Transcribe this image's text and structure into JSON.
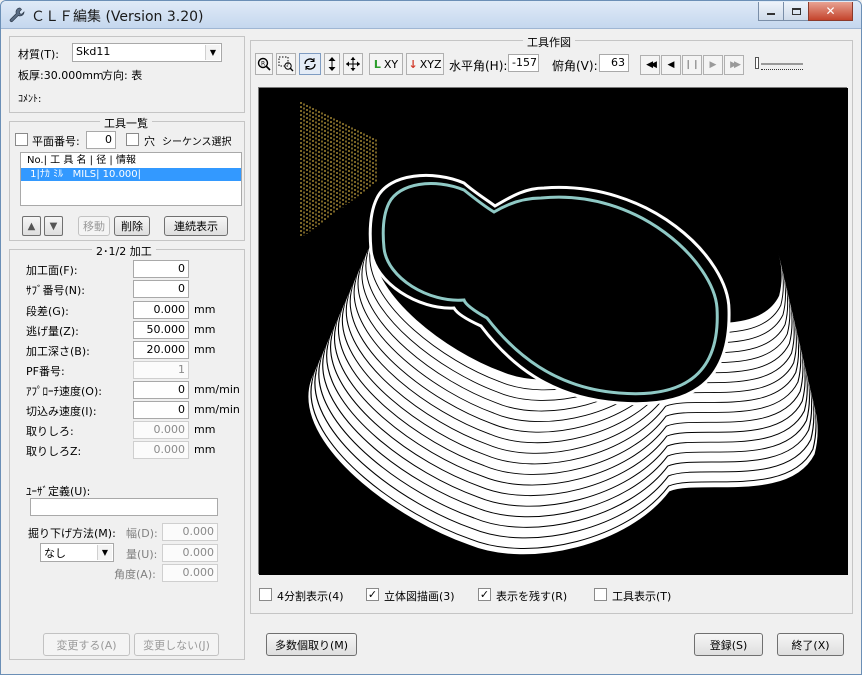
{
  "window": {
    "title": "ＣＬＦ編集 (Version 3.20)",
    "icon": "wrench-icon",
    "min_icon": "minimize-icon",
    "max_icon": "maximize-icon",
    "close_icon": "close-icon"
  },
  "material": {
    "label": "材質(T):",
    "value": "Skd11",
    "thickness_line": "板厚:30.000mm",
    "direction_line": "方向: 表",
    "comment_label": "ｺﾒﾝﾄ:"
  },
  "tool_list": {
    "title": "工具一覧",
    "plane_label": "平面番号:",
    "plane_value": "0",
    "hole_label": "穴",
    "sequence_label": "シーケンス選択",
    "header": "No.| 工 具 名 | 径 | 情報",
    "rows": [
      {
        "text": " 1|ﾅｶ ﾐﾙ   MILS| 10.000|"
      }
    ],
    "up_label": "▲",
    "down_label": "▼",
    "move_label": "移動",
    "delete_label": "削除",
    "continuous_label": "連続表示"
  },
  "machining": {
    "title": "2･1/2 加工",
    "rows": [
      {
        "label": "加工面(F):",
        "value": "0",
        "unit": "",
        "enabled": true
      },
      {
        "label": "ｻﾌﾞ番号(N):",
        "value": "0",
        "unit": "",
        "enabled": true
      },
      {
        "label": "段差(G):",
        "value": "0.000",
        "unit": "mm",
        "enabled": true
      },
      {
        "label": "逃げ量(Z):",
        "value": "50.000",
        "unit": "mm",
        "enabled": true
      },
      {
        "label": "加工深さ(B):",
        "value": "20.000",
        "unit": "mm",
        "enabled": true
      },
      {
        "label": "PF番号:",
        "value": "1",
        "unit": "",
        "enabled": false
      },
      {
        "label": "ｱﾌﾟﾛｰﾁ速度(O):",
        "value": "0",
        "unit": "mm/min",
        "enabled": true
      },
      {
        "label": "切込み速度(I):",
        "value": "0",
        "unit": "mm/min",
        "enabled": true
      },
      {
        "label": "取りしろ:",
        "value": "0.000",
        "unit": "mm",
        "enabled": false
      },
      {
        "label": "取りしろZ:",
        "value": "0.000",
        "unit": "mm",
        "enabled": false
      }
    ],
    "user_def_label": "ﾕｰｻﾞ定義(U):",
    "user_def_value": "",
    "dig_label": "掘り下げ方法(M):",
    "dig_value": "なし",
    "width_label": "幅(D):",
    "width_value": "0.000",
    "amount_label": "量(U):",
    "amount_value": "0.000",
    "angle_label": "角度(A):",
    "angle_value": "0.000",
    "apply_label": "変更する(A)",
    "cancel_label": "変更しない(J)"
  },
  "drawing": {
    "title": "工具作図",
    "zoom_icon": "zoom-icon",
    "zoom_rect_icon": "zoom-rect-icon",
    "rotate_icon": "rotate-icon",
    "updown_icon": "up-down-icon",
    "move_icon": "move-icon",
    "xy_label": "XY",
    "xyz_label": "XYZ",
    "h_angle_label": "水平角(H):",
    "h_angle_value": "-157",
    "v_angle_label": "俯角(V):",
    "v_angle_value": "63",
    "play_icons": [
      "rewind-icon",
      "step-back-icon",
      "pause-icon",
      "step-forward-icon",
      "fast-forward-icon"
    ],
    "split4_label": "4分割表示(4)",
    "split4_checked": false,
    "solid_label": "立体図描画(3)",
    "solid_checked": true,
    "keep_label": "表示を残す(R)",
    "keep_checked": true,
    "tool_show_label": "工具表示(T)",
    "tool_show_checked": false,
    "colors": {
      "background": "#000000",
      "path": "#ffffff",
      "contour": "#8fc9c5",
      "tool": "#f2c84b"
    }
  },
  "footer": {
    "multi_label": "多数個取り(M)",
    "register_label": "登録(S)",
    "exit_label": "終了(X)"
  }
}
